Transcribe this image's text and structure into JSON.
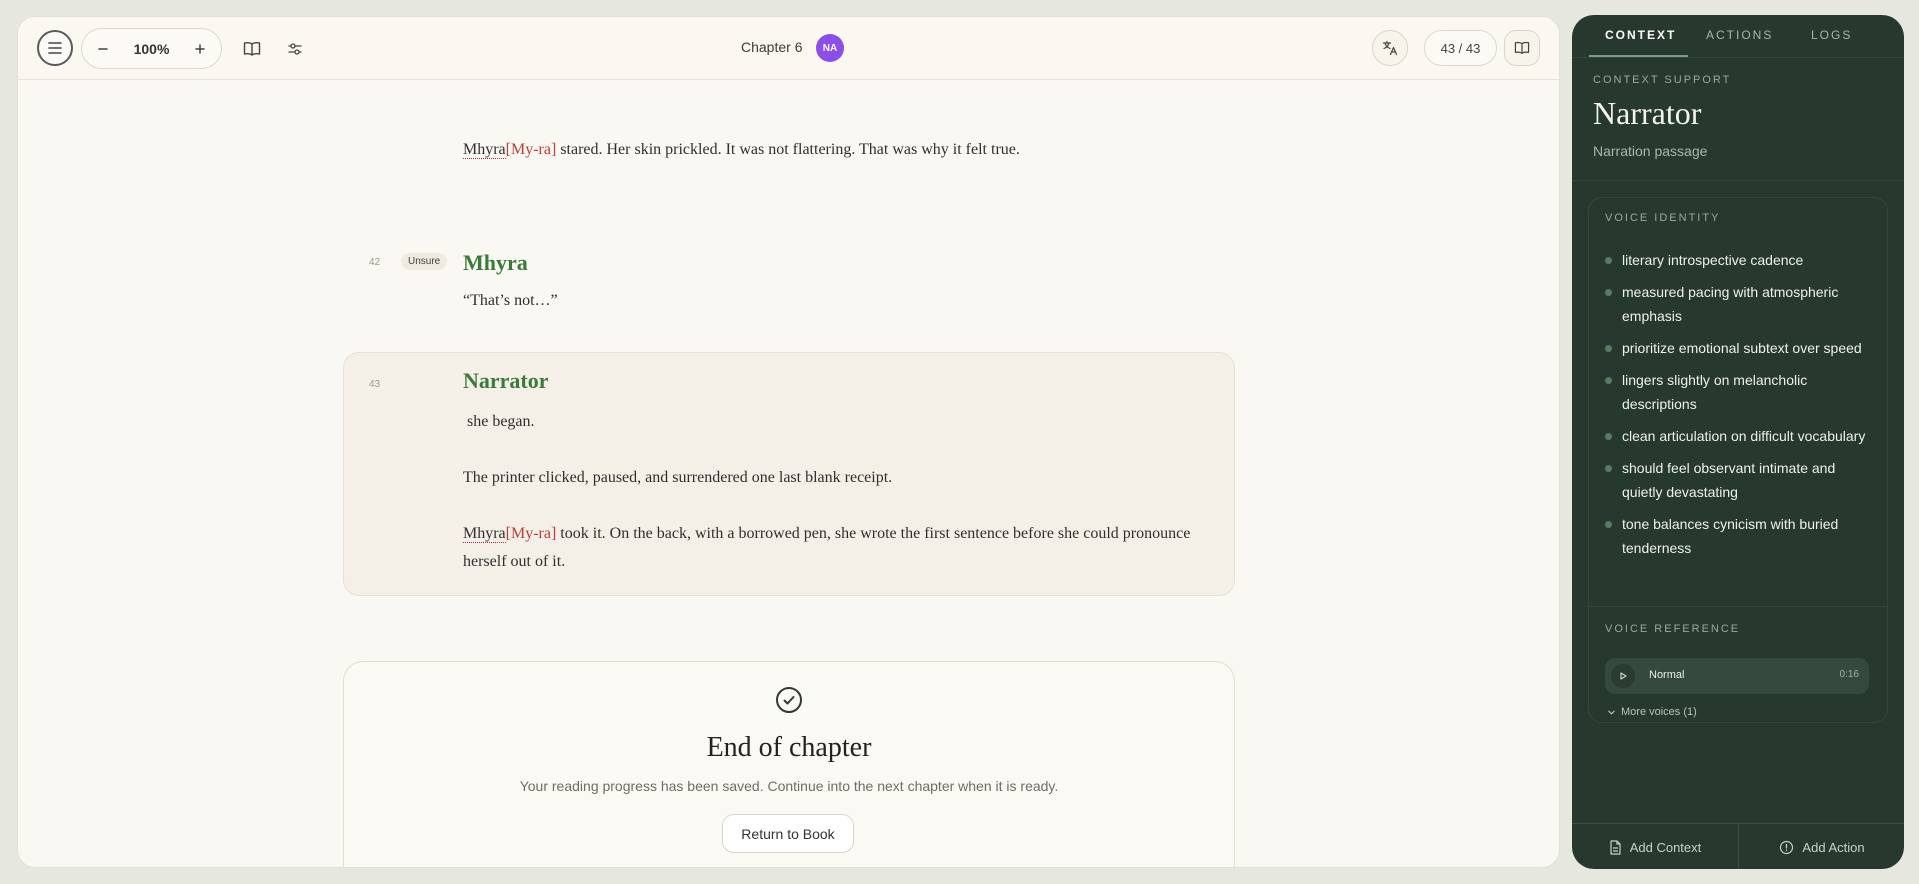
{
  "toolbar": {
    "zoom": "100%",
    "chapter_title": "Chapter 6",
    "avatar_initials": "NA",
    "page_indicator": "43 / 43"
  },
  "reader": {
    "para_top": {
      "name": "Mhyra",
      "pronunciation": "[My-ra]",
      "text": " stared. Her skin prickled. It was not flattering. That was why it felt true."
    },
    "segment_42": {
      "number": "42",
      "badge": "Unsure",
      "speaker": "Mhyra",
      "text": "“That’s not…”"
    },
    "segment_43": {
      "number": "43",
      "speaker": "Narrator",
      "line1": " she began.",
      "line2": "The printer clicked, paused, and surrendered one last blank receipt.",
      "line3_name": "Mhyra",
      "line3_pron": "[My-ra]",
      "line3_text_a": " took it. On the back, with a borrowed pen, she wrote the first sentence before she could pronounce",
      "line3_text_b": "herself out of it."
    },
    "end": {
      "title": "End of chapter",
      "subtitle": "Your reading progress has been saved. Continue into the next chapter when it is ready.",
      "button": "Return to Book"
    }
  },
  "panel": {
    "tabs": [
      "CONTEXT",
      "ACTIONS",
      "LOGS"
    ],
    "kicker": "CONTEXT SUPPORT",
    "title": "Narrator",
    "subtitle": "Narration passage",
    "voice_identity_heading": "VOICE IDENTITY",
    "voice_identity": [
      "literary introspective cadence",
      "measured pacing with atmospheric emphasis",
      "prioritize emotional subtext over speed",
      "lingers slightly on melancholic descriptions",
      "clean articulation on difficult vocabulary",
      "should feel observant intimate and quietly devastating",
      "tone balances cynicism with buried tenderness"
    ],
    "voice_reference_heading": "VOICE REFERENCE",
    "voice_reference": {
      "label": "Normal",
      "duration": "0:16"
    },
    "more_voices": "More voices (1)",
    "footer": {
      "add_context": "Add Context",
      "add_action": "Add Action"
    }
  },
  "colors": {
    "accent_green": "#3a7a3a",
    "pronunciation_red": "#b5403a",
    "panel_bg": "#27382e",
    "avatar_purple": "#8b4ee8"
  }
}
